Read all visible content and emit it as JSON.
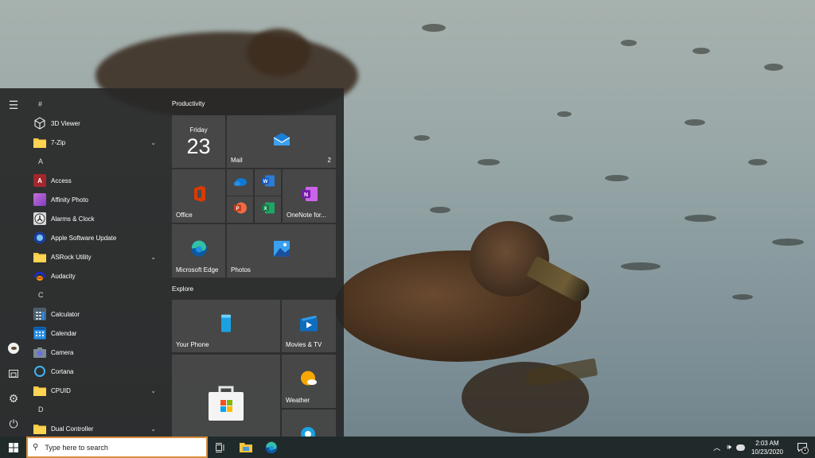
{
  "start_menu": {
    "rail": {
      "menu_icon": "hamburger-icon",
      "user_icon": "user-avatar",
      "documents_icon": "documents-icon",
      "settings_icon": "gear-icon",
      "power_icon": "power-icon"
    },
    "app_list": [
      {
        "type": "letter",
        "label": "#"
      },
      {
        "type": "app",
        "label": "3D Viewer",
        "icon": "3d-viewer-icon"
      },
      {
        "type": "folder",
        "label": "7-Zip",
        "icon": "folder-icon"
      },
      {
        "type": "letter",
        "label": "A"
      },
      {
        "type": "app",
        "label": "Access",
        "icon": "access-icon"
      },
      {
        "type": "app",
        "label": "Affinity Photo",
        "icon": "affinity-photo-icon"
      },
      {
        "type": "app",
        "label": "Alarms & Clock",
        "icon": "alarms-clock-icon"
      },
      {
        "type": "app",
        "label": "Apple Software Update",
        "icon": "apple-software-update-icon"
      },
      {
        "type": "folder",
        "label": "ASRock Utility",
        "icon": "folder-icon"
      },
      {
        "type": "app",
        "label": "Audacity",
        "icon": "audacity-icon"
      },
      {
        "type": "letter",
        "label": "C"
      },
      {
        "type": "app",
        "label": "Calculator",
        "icon": "calculator-icon"
      },
      {
        "type": "app",
        "label": "Calendar",
        "icon": "calendar-icon"
      },
      {
        "type": "app",
        "label": "Camera",
        "icon": "camera-icon"
      },
      {
        "type": "app",
        "label": "Cortana",
        "icon": "cortana-icon"
      },
      {
        "type": "folder",
        "label": "CPUID",
        "icon": "folder-icon"
      },
      {
        "type": "letter",
        "label": "D"
      },
      {
        "type": "folder",
        "label": "Dual Controller",
        "icon": "folder-icon"
      }
    ],
    "groups": {
      "productivity": "Productivity",
      "explore": "Explore"
    },
    "tiles": {
      "calendar": {
        "day": "Friday",
        "date": "23"
      },
      "mail": {
        "label": "Mail",
        "count": "2"
      },
      "office": {
        "label": "Office"
      },
      "onenote": {
        "label": "OneNote for..."
      },
      "edge": {
        "label": "Microsoft Edge"
      },
      "photos": {
        "label": "Photos"
      },
      "your_phone": {
        "label": "Your Phone"
      },
      "movies": {
        "label": "Movies & TV"
      },
      "weather": {
        "label": "Weather"
      },
      "store": {
        "label": ""
      }
    }
  },
  "taskbar": {
    "search_placeholder": "Type here to search",
    "time": "2:03 AM",
    "date": "10/23/2020",
    "notification_count": "1"
  }
}
